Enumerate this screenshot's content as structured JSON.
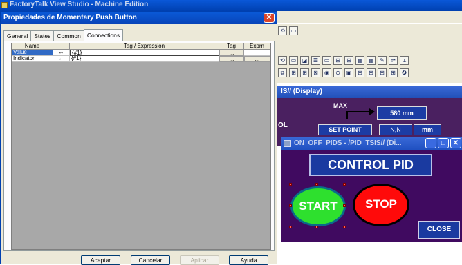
{
  "app": {
    "title": "FactoryTalk View Studio - Machine Edition",
    "toolbar_row1": [
      "⟲",
      "▭",
      "◪",
      "☰",
      "▭",
      "⊞",
      "⊟",
      "▦",
      "▦",
      "✎",
      "⇌",
      "⟂"
    ],
    "toolbar_row2": [
      "⧉",
      "⊞",
      "⊞",
      "⊠",
      "◉",
      "⊙",
      "▣",
      "⊟",
      "⊞",
      "⊞",
      "⊞",
      "✪"
    ]
  },
  "display_window": {
    "title": "IS// (Display)",
    "max_label": "MAX",
    "max_value": "580 mm",
    "left_label": "OL",
    "set_point_label": "SET POINT",
    "nn_value": "N,N",
    "unit": "mm"
  },
  "hmi_window": {
    "title": "ON_OFF_PIDS - /PID_TSIS// (Di...",
    "control_title": "CONTROL PID",
    "start_label": "START",
    "stop_label": "STOP",
    "close_label": "CLOSE"
  },
  "dialog": {
    "title": "Propiedades de Momentary Push Button",
    "close_glyph": "✕",
    "tabs": [
      "General",
      "States",
      "Common",
      "Connections"
    ],
    "active_tab": "Connections",
    "columns": {
      "name": "Name",
      "tag_expression": "Tag / Expression",
      "tag": "Tag",
      "exprn": "Exprn"
    },
    "rows": [
      {
        "name": "Value",
        "direction": "↔",
        "expression": "{#1}",
        "tag_btn": "...",
        "exprn_btn": ""
      },
      {
        "name": "Indicator",
        "direction": "←",
        "expression": "{#1}",
        "tag_btn": "...",
        "exprn_btn": "..."
      }
    ],
    "buttons": {
      "accept": "Aceptar",
      "cancel": "Cancelar",
      "apply": "Aplicar",
      "help": "Ayuda"
    }
  },
  "colors": {
    "title_blue": "#0a58d8",
    "hmi_background": "#400a60",
    "start_green": "#2ee02e",
    "stop_red": "#ff0a0a",
    "selection_blue": "#316ac5"
  }
}
